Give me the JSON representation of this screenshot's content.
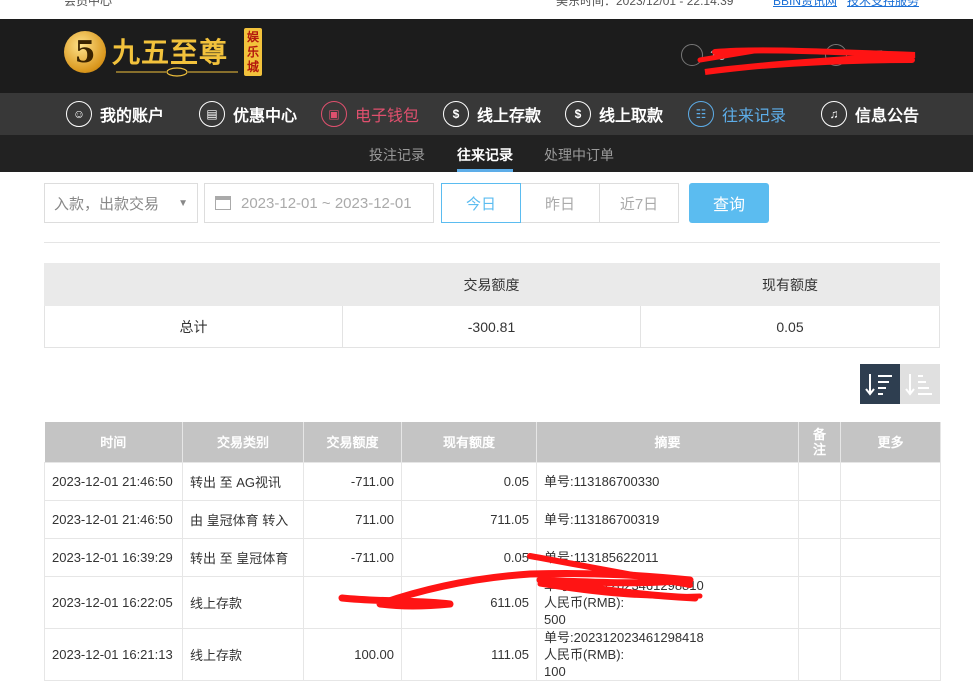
{
  "top_strip": {
    "member_center": "会员中心",
    "time_label": "美东时间：2023/12/01 - 22:14:39",
    "link_bbin": "BBIN资讯网",
    "link_support": "技术支持服务"
  },
  "header": {
    "logo_title": "九五至尊",
    "logo_tag": "娱乐城",
    "account_partial": "5",
    "balance_partial": "0.05",
    "username_partial": "36"
  },
  "nav": [
    {
      "label": "我的账户",
      "icon": "user-icon"
    },
    {
      "label": "优惠中心",
      "icon": "gift-icon"
    },
    {
      "label": "电子钱包",
      "icon": "wallet-icon"
    },
    {
      "label": "线上存款",
      "icon": "deposit-icon"
    },
    {
      "label": "线上取款",
      "icon": "withdraw-icon"
    },
    {
      "label": "往来记录",
      "icon": "record-icon"
    },
    {
      "label": "信息公告",
      "icon": "bell-icon"
    }
  ],
  "subnav": [
    "投注记录",
    "往来记录",
    "处理中订单"
  ],
  "filter": {
    "type_select": "入款，出款交易",
    "date_range": "2023-12-01 ~ 2023-12-01",
    "btn_today": "今日",
    "btn_yesterday": "昨日",
    "btn_7days": "近7日",
    "btn_query": "查询"
  },
  "summary": {
    "headers": [
      "",
      "交易额度",
      "现有额度"
    ],
    "row": [
      "总计",
      "-300.81",
      "0.05"
    ]
  },
  "records": {
    "headers": [
      "时间",
      "交易类别",
      "交易额度",
      "现有额度",
      "摘要",
      "备注",
      "更多"
    ],
    "rows": [
      {
        "time": "2023-12-01 21:46:50",
        "type": "转出 至 AG视讯",
        "amount": "-711.00",
        "balance": "0.05",
        "summary": "单号:113186700330"
      },
      {
        "time": "2023-12-01 21:46:50",
        "type": "由 皇冠体育 转入",
        "amount": "711.00",
        "balance": "711.05",
        "summary": "单号:113186700319"
      },
      {
        "time": "2023-12-01 16:39:29",
        "type": "转出 至 皇冠体育",
        "amount": "-711.00",
        "balance": "0.05",
        "summary": "单号:113185622011"
      },
      {
        "time": "2023-12-01 16:22:05",
        "type": "线上存款",
        "amount": "",
        "balance": "611.05",
        "summary": "单号:202312023461298810",
        "summary2": "人民币(RMB):",
        "summary3": "500"
      },
      {
        "time": "2023-12-01 16:21:13",
        "type": "线上存款",
        "amount": "100.00",
        "balance": "111.05",
        "summary": "单号:202312023461298418",
        "summary2": "人民币(RMB):",
        "summary3": "100"
      }
    ]
  },
  "colors": {
    "accent_blue": "#5bbcf0",
    "nav_red": "#e0506e",
    "scribble_red": "#ff1414"
  }
}
